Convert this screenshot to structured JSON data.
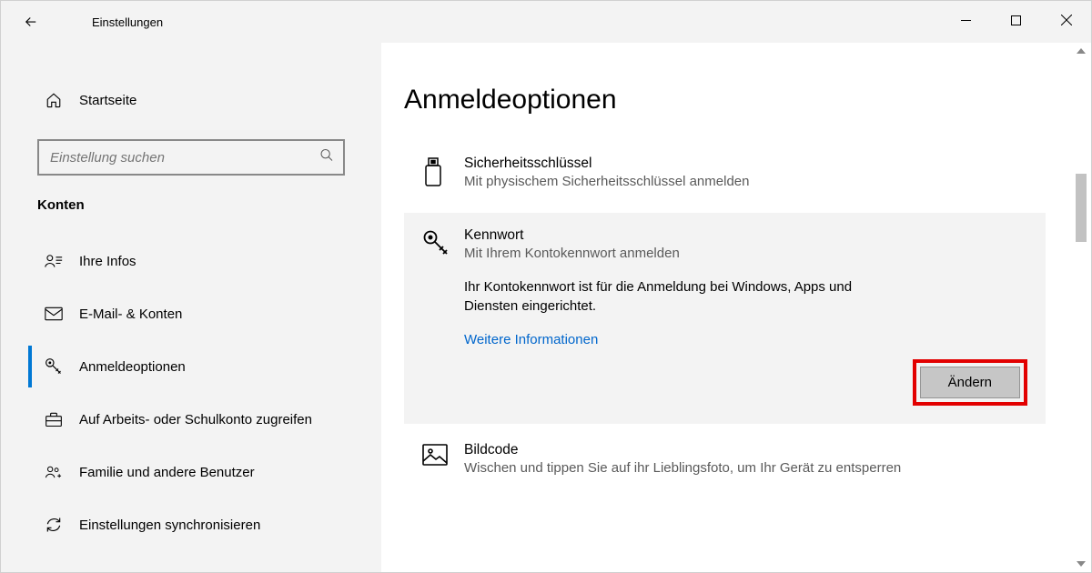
{
  "titlebar": {
    "title": "Einstellungen"
  },
  "sidebar": {
    "home_label": "Startseite",
    "search_placeholder": "Einstellung suchen",
    "section_header": "Konten",
    "items": [
      {
        "label": "Ihre Infos"
      },
      {
        "label": "E-Mail- & Konten"
      },
      {
        "label": "Anmeldeoptionen"
      },
      {
        "label": "Auf Arbeits- oder Schulkonto zugreifen"
      },
      {
        "label": "Familie und andere Benutzer"
      },
      {
        "label": "Einstellungen synchronisieren"
      }
    ]
  },
  "content": {
    "heading": "Anmeldeoptionen",
    "options": {
      "security_key": {
        "title": "Sicherheitsschlüssel",
        "subtitle": "Mit physischem Sicherheitsschlüssel anmelden"
      },
      "password": {
        "title": "Kennwort",
        "subtitle": "Mit Ihrem Kontokennwort anmelden",
        "description": "Ihr Kontokennwort ist für die Anmeldung bei Windows, Apps und Diensten eingerichtet.",
        "learn_more": "Weitere Informationen",
        "change_button": "Ändern"
      },
      "picture_password": {
        "title": "Bildcode",
        "subtitle": "Wischen und tippen Sie auf ihr Lieblingsfoto, um Ihr Gerät zu entsperren"
      }
    }
  }
}
